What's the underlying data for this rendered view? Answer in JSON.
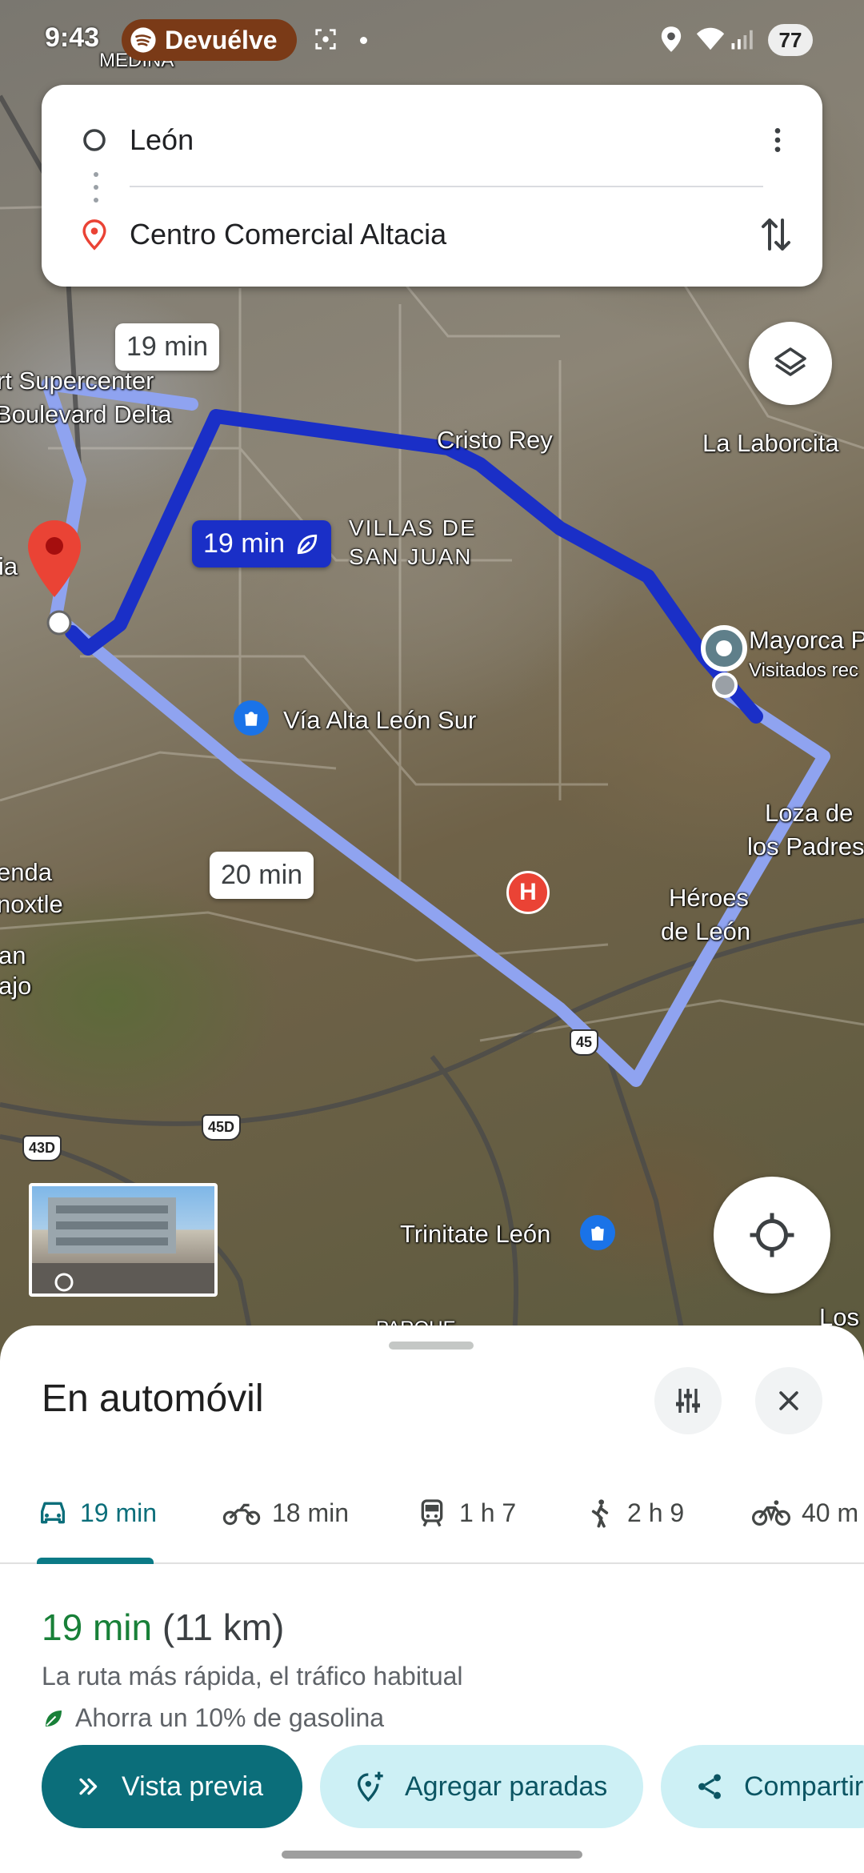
{
  "status_bar": {
    "time": "9:43",
    "notification_chip": "Devuélve",
    "battery": "77"
  },
  "route_inputs": {
    "origin": "León",
    "destination": "Centro Comercial Altacia"
  },
  "map": {
    "labels": {
      "medina": "MEDINA",
      "supercenter": "rt Supercenter",
      "boulevard": "Boulevard Delta",
      "cristo_rey": "Cristo Rey",
      "la_laborcita": "La Laborcita",
      "villas_1": "VILLAS DE",
      "villas_2": "SAN JUAN",
      "mayorca": "Mayorca P",
      "visitados": "Visitados rec",
      "via_alta": "Vía Alta León Sur",
      "loza_1": "Loza de",
      "loza_2": "los Padres",
      "heroes_1": "Héroes",
      "heroes_2": "de León",
      "enda": "enda",
      "noxtle": "noxtle",
      "an": "an",
      "ajo": "ajo",
      "ia": "ia",
      "trinitate": "Trinitate León",
      "los": "Los",
      "parque": "PARQUE"
    },
    "shields": {
      "h45": "45",
      "h45d": "45D",
      "h43d": "43D"
    },
    "route_bubbles": {
      "alt_top": "19 min",
      "selected": "19 min",
      "alt_bottom": "20 min"
    }
  },
  "sheet": {
    "title": "En automóvil",
    "modes": [
      {
        "label": "19 min",
        "icon": "car-icon"
      },
      {
        "label": "18 min",
        "icon": "motorcycle-icon"
      },
      {
        "label": "1 h 7",
        "icon": "transit-icon"
      },
      {
        "label": "2 h 9",
        "icon": "walk-icon"
      },
      {
        "label": "40 m",
        "icon": "bike-icon"
      }
    ],
    "summary": {
      "time": "19 min",
      "distance": "(11 km)",
      "description": "La ruta más rápida, el tráfico habitual",
      "eco": "Ahorra un 10% de gasolina"
    },
    "actions": {
      "preview": "Vista previa",
      "add_stops": "Agregar paradas",
      "share": "Compartir"
    }
  },
  "colors": {
    "selected_route": "#1a2fc7",
    "alt_route": "#8fa3f0",
    "accent": "#0b6e7a",
    "eco_green": "#188038",
    "pin_red": "#ea4335"
  }
}
